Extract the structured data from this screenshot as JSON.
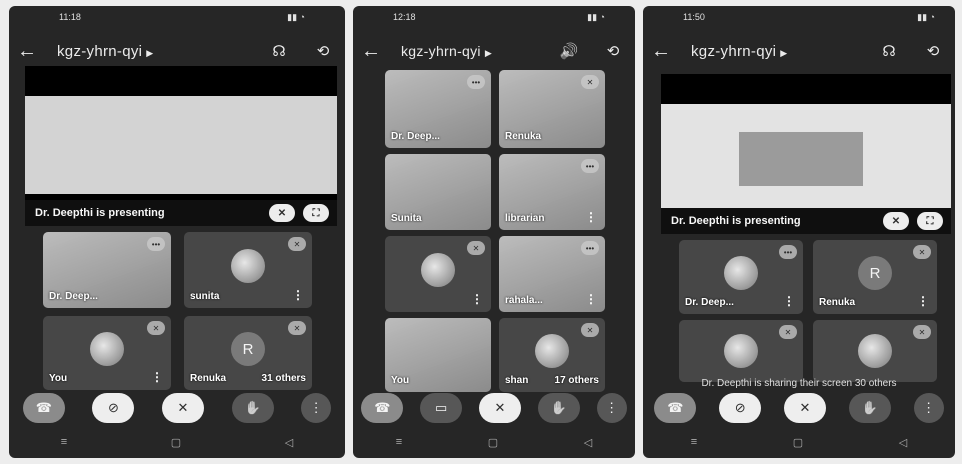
{
  "meeting_code": "kgz-yhrn-qyi",
  "phone1": {
    "time": "11:18",
    "presenting_label": "Dr. Deepthi is presenting",
    "tiles": [
      {
        "name": "Dr. Deep..."
      },
      {
        "name": "sunita"
      },
      {
        "name": "You"
      },
      {
        "name": "Renuka",
        "letter": "R",
        "others": "31 others"
      }
    ]
  },
  "phone2": {
    "time": "12:18",
    "tiles": [
      {
        "name": "Dr. Deep..."
      },
      {
        "name": "Renuka"
      },
      {
        "name": "Sunita"
      },
      {
        "name": "librarian"
      },
      {
        "name": ""
      },
      {
        "name": "rahala..."
      },
      {
        "name": "You"
      },
      {
        "name": "shan",
        "others": "17 others"
      }
    ]
  },
  "phone3": {
    "time": "11:50",
    "presenting_label": "Dr. Deepthi is presenting",
    "tiles": [
      {
        "name": "Dr. Deep..."
      },
      {
        "name": "Renuka",
        "letter": "R"
      },
      {
        "name": ""
      },
      {
        "name": ""
      }
    ],
    "share_text": "Dr. Deepthi is sharing their screen",
    "others": "30 others"
  },
  "icons": {
    "back": "←",
    "headphones": "☊",
    "volume": "🔊",
    "flip": "⟲",
    "end_call": "☎",
    "camera_off": "⊘",
    "mic_off": "✕",
    "raise_hand": "✋",
    "more": "⋮",
    "nav_menu": "≡",
    "nav_home": "▢",
    "nav_back": "◁"
  }
}
